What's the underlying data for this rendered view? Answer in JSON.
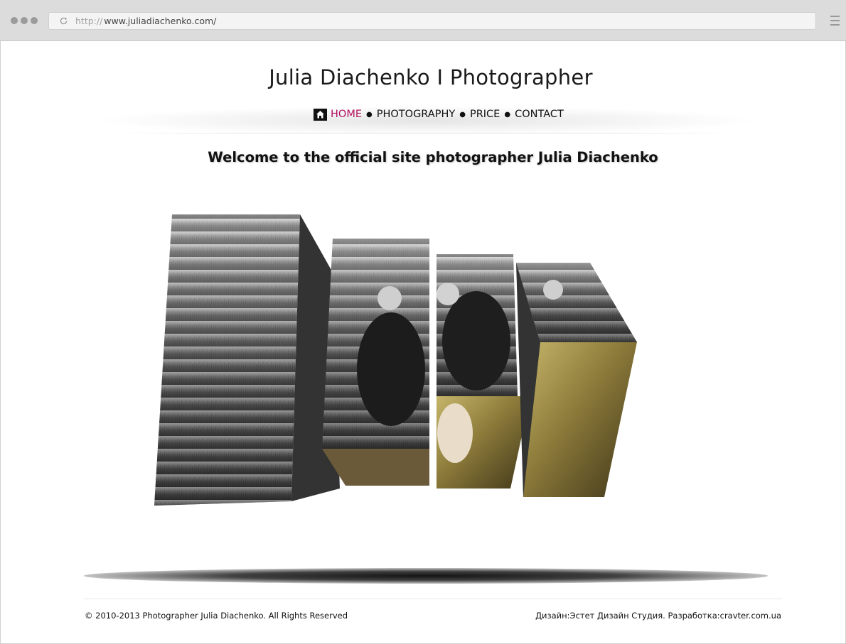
{
  "browser": {
    "url_scheme": "http://",
    "url_host": "www.juliadiachenko.com/"
  },
  "site": {
    "title": "Julia Diachenko  I  Photographer",
    "nav": [
      {
        "label": "HOME",
        "active": true,
        "icon": "home-icon"
      },
      {
        "label": "PHOTOGRAPHY",
        "active": false
      },
      {
        "label": "PRICE",
        "active": false
      },
      {
        "label": "CONTACT",
        "active": false
      }
    ],
    "nav_separator": "●",
    "welcome": "Welcome to the official site photographer Julia Diachenko",
    "accent_color": "#b0105f"
  },
  "footer": {
    "copyright": "© 2010-2013 Photographer Julia Diachenko. All Rights Reserved",
    "credits": "Дизайн:Эстет Дизайн Студия. Разработка:cravter.com.ua"
  }
}
